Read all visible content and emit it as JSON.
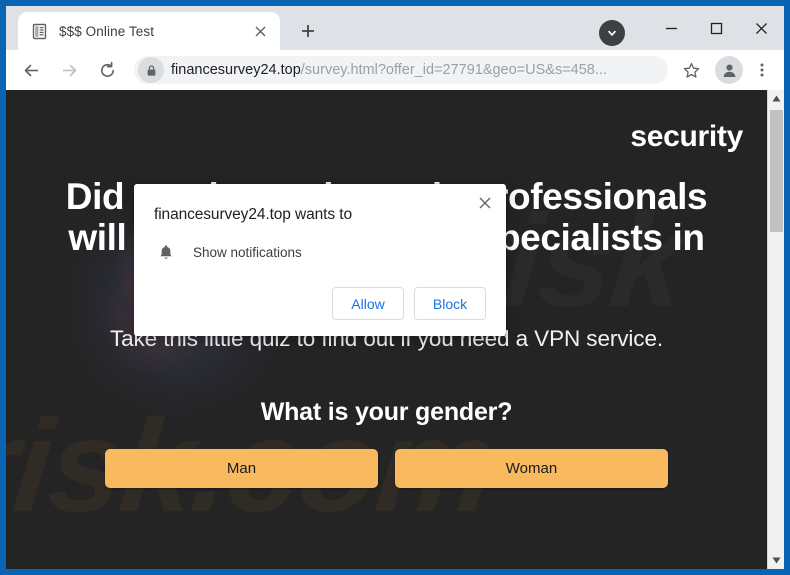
{
  "browser": {
    "tab": {
      "favicon_icon": "document-list-icon",
      "title": "$$$ Online Test",
      "close_icon": "close-icon"
    },
    "new_tab_icon": "plus-icon",
    "tab_search_icon": "chevron-down-icon",
    "window_controls": {
      "minimize_icon": "minimize-icon",
      "maximize_icon": "maximize-icon",
      "close_icon": "close-icon"
    },
    "toolbar": {
      "back_icon": "arrow-left-icon",
      "forward_icon": "arrow-right-icon",
      "reload_icon": "reload-icon",
      "lock_icon": "lock-icon",
      "url_host": "financesurvey24.top",
      "url_path": "/survey.html?offer_id=27791&geo=US&s=458...",
      "bookmark_icon": "star-icon",
      "profile_icon": "avatar-icon",
      "menu_icon": "three-dots-icon"
    },
    "frame_color": "#0a64b4",
    "tabstrip_color": "#dee1e6"
  },
  "dialog": {
    "title": "financesurvey24.top wants to",
    "permission_icon": "bell-icon",
    "permission_label": "Show notifications",
    "allow_label": "Allow",
    "block_label": "Block",
    "close_icon": "close-icon",
    "button_text_color": "#1a73e8"
  },
  "page": {
    "background_color": "#242424",
    "brand_logo": "security",
    "watermark_bottom": "risk.com",
    "watermark_top": "pcrisk",
    "headline": "Did you know that only professionals will be the highest-paid specialists in 2022?",
    "subheadline": "Take this little quiz to find out if you need a VPN service.",
    "question": "What is your gender?",
    "answers": [
      {
        "label": "Man"
      },
      {
        "label": "Woman"
      }
    ],
    "answer_button_color": "#f8b95f",
    "scrollbar": {
      "up_arrow_icon": "caret-up-icon",
      "down_arrow_icon": "caret-down-icon"
    }
  }
}
